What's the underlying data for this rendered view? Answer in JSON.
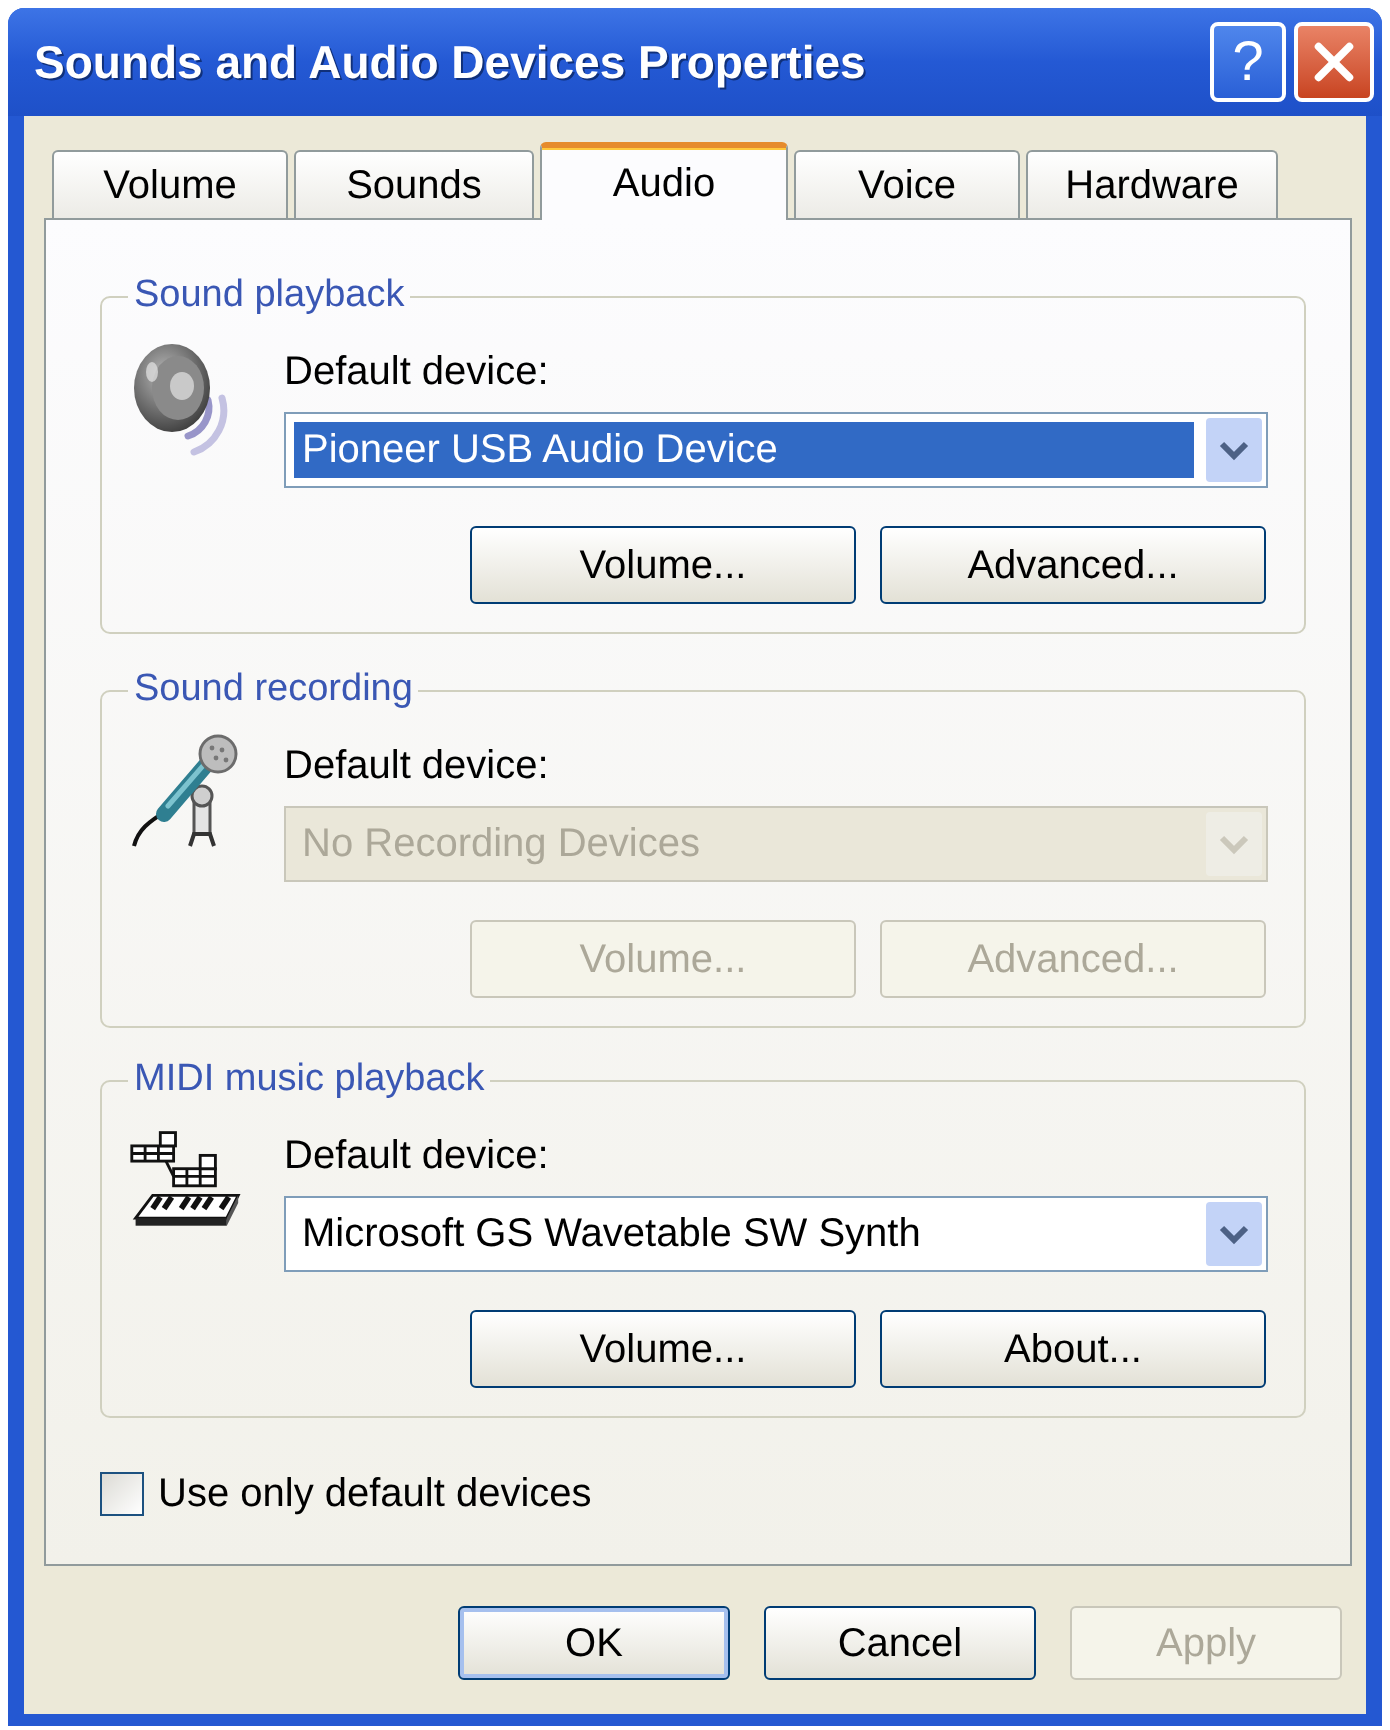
{
  "window": {
    "title": "Sounds and Audio Devices Properties",
    "title_buttons": [
      {
        "kind": "help",
        "label": "?"
      },
      {
        "kind": "close"
      }
    ]
  },
  "tabs": [
    {
      "label": "Volume",
      "selected": false
    },
    {
      "label": "Sounds",
      "selected": false
    },
    {
      "label": "Audio",
      "selected": true
    },
    {
      "label": "Voice",
      "selected": false
    },
    {
      "label": "Hardware",
      "selected": false
    }
  ],
  "groups": [
    {
      "kind": "speaker",
      "legend": "Sound playback",
      "device_label": "Default device:",
      "device": {
        "value": "Pioneer USB Audio Device",
        "focused": true,
        "disabled": false
      },
      "buttons": [
        {
          "label": "Volume...",
          "disabled": false
        },
        {
          "label": "Advanced...",
          "disabled": false
        }
      ]
    },
    {
      "kind": "microphone",
      "legend": "Sound recording",
      "device_label": "Default device:",
      "device": {
        "value": "No Recording Devices",
        "focused": false,
        "disabled": true
      },
      "buttons": [
        {
          "label": "Volume...",
          "disabled": true
        },
        {
          "label": "Advanced...",
          "disabled": true
        }
      ]
    },
    {
      "kind": "midi",
      "legend": "MIDI music playback",
      "device_label": "Default device:",
      "device": {
        "value": "Microsoft GS Wavetable SW Synth",
        "focused": false,
        "disabled": false
      },
      "buttons": [
        {
          "label": "Volume...",
          "disabled": false
        },
        {
          "label": "About...",
          "disabled": false
        }
      ]
    }
  ],
  "checkbox": {
    "label": "Use only default devices",
    "checked": false
  },
  "buttons": [
    {
      "label": "OK",
      "default": true,
      "disabled": false
    },
    {
      "label": "Cancel",
      "default": false,
      "disabled": false
    },
    {
      "label": "Apply",
      "default": false,
      "disabled": true
    }
  ]
}
